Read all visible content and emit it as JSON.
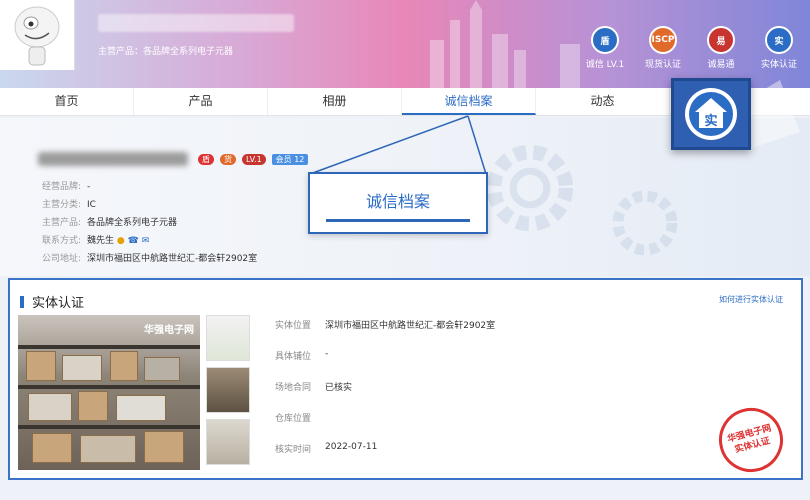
{
  "header": {
    "main_products": "主营产品：各品牌全系列电子元器",
    "badges": [
      {
        "label": "诚信 LV.1",
        "icon": "honesty-shield-icon",
        "color": "#2b6cc4",
        "text": "盾"
      },
      {
        "label": "现货认证",
        "icon": "iscp-icon",
        "color": "#e06a2a",
        "text": "ISCP"
      },
      {
        "label": "诚易通",
        "icon": "chengyitong-icon",
        "color": "#c8342f",
        "text": "易"
      },
      {
        "label": "实体认证",
        "icon": "entity-house-icon",
        "color": "#2b6cc4",
        "text": "实"
      }
    ]
  },
  "nav": {
    "items": [
      "首页",
      "产品",
      "相册",
      "诚信档案",
      "动态"
    ]
  },
  "info": {
    "level_badge": "LV.1",
    "member_badge": "会员",
    "member_years": "12",
    "rows": [
      {
        "label": "经营品牌:",
        "value": "-"
      },
      {
        "label": "主营分类:",
        "value": "IC"
      },
      {
        "label": "主营产品:",
        "value": "各品牌全系列电子元器"
      },
      {
        "label": "联系方式:",
        "value": "魏先生"
      },
      {
        "label": "公司地址:",
        "value": "深圳市福田区中航路世纪汇-都会轩2902室"
      }
    ]
  },
  "callout": {
    "text": "诚信档案"
  },
  "zoom": {
    "text": "实"
  },
  "card": {
    "title": "实体认证",
    "link": "如何进行实体认证",
    "photo_logo": "华强电子网",
    "details": [
      {
        "label": "实体位置",
        "value": "深圳市福田区中航路世纪汇-都会轩2902室"
      },
      {
        "label": "具体铺位",
        "value": "-"
      },
      {
        "label": "场地合同",
        "value": "已核实"
      },
      {
        "label": "仓库位置",
        "value": ""
      },
      {
        "label": "核实时间",
        "value": "2022-07-11"
      }
    ],
    "stamp": "华强电子网 实体认证"
  },
  "colors": {
    "accent": "#2b6cc4",
    "stamp": "#dd3333"
  }
}
